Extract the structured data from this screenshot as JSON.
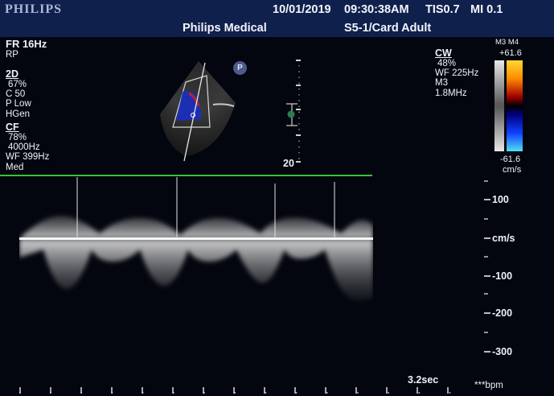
{
  "header": {
    "brand": "PHILIPS",
    "date": "10/01/2019",
    "time": "09:30:38AM",
    "tis": "TIS0.7",
    "mi": "MI 0.1",
    "institution": "Philips Medical",
    "preset": "S5-1/Card Adult",
    "colors": {
      "bar": "#10204c",
      "brand": "#aeb9d6"
    }
  },
  "imaging": {
    "frame_rate": "FR 16Hz",
    "orientation": "RP",
    "mode_2d": {
      "title": "2D",
      "lines": [
        "67%",
        "C 50",
        "P Low",
        "HGen"
      ]
    },
    "mode_cf": {
      "title": "CF",
      "lines": [
        "78%",
        "4000Hz",
        "WF 399Hz",
        "Med"
      ]
    },
    "icon_letter": "P",
    "depth_label": "20"
  },
  "cw": {
    "title": "CW",
    "lines": [
      "48%",
      "WF 225Hz",
      "M3",
      "1.8MHz"
    ]
  },
  "color_map": {
    "label": "M3 M4",
    "max": "+61.6",
    "min": "-61.6",
    "unit": "cm/s",
    "colors": {
      "positive_top": "#ffd830",
      "negative_bottom": "#50e0f0"
    }
  },
  "doppler_scale": {
    "labels": [
      "100",
      "cm/s",
      "-100",
      "-200",
      "-300"
    ]
  },
  "timebar": {
    "duration": "3.2sec",
    "heart_rate": "***bpm"
  }
}
